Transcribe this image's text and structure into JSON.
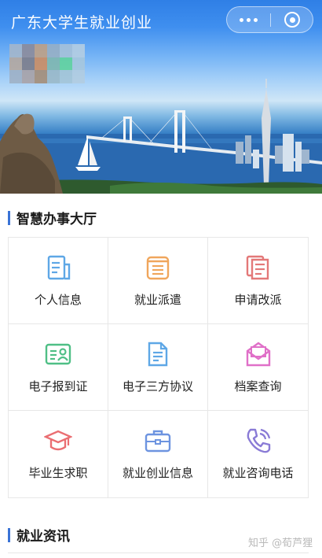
{
  "header": {
    "title": "广东大学生就业创业",
    "more_icon": "more-dots-icon",
    "close_icon": "mini-program-close-icon"
  },
  "banner": {
    "description_icon": "bridge-city-photo"
  },
  "service_hall": {
    "title": "智慧办事大厅",
    "items": [
      {
        "label": "个人信息",
        "icon": "document-icon",
        "color": "#5ea7e6"
      },
      {
        "label": "就业派遣",
        "icon": "notepad-icon",
        "color": "#f0a65c"
      },
      {
        "label": "申请改派",
        "icon": "copy-document-icon",
        "color": "#e37878"
      },
      {
        "label": "电子报到证",
        "icon": "id-card-icon",
        "color": "#4fbf86"
      },
      {
        "label": "电子三方协议",
        "icon": "contract-icon",
        "color": "#5ea7e6"
      },
      {
        "label": "档案查询",
        "icon": "mail-icon",
        "color": "#e070c8"
      },
      {
        "label": "毕业生求职",
        "icon": "graduation-cap-icon",
        "color": "#ea6e72"
      },
      {
        "label": "就业创业信息",
        "icon": "briefcase-icon",
        "color": "#6d94e0"
      },
      {
        "label": "就业咨询电话",
        "icon": "phone-icon",
        "color": "#8a7bd6"
      }
    ]
  },
  "news": {
    "title": "就业资讯"
  },
  "watermark": "知乎 @荀芦狸"
}
